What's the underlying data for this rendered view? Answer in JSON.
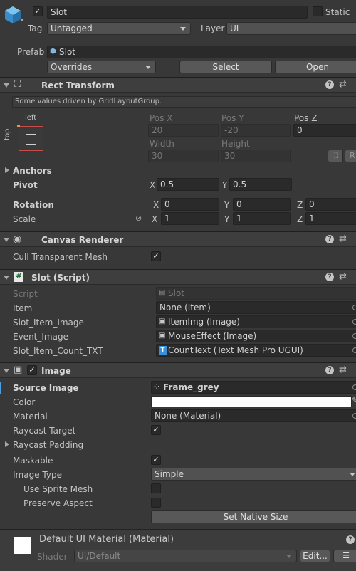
{
  "object": {
    "name": "Slot",
    "static_label": "Static",
    "tag_label": "Tag",
    "tag_value": "Untagged",
    "layer_label": "Layer",
    "layer_value": "UI"
  },
  "prefab": {
    "label": "Prefab",
    "value": "Slot",
    "overrides": "Overrides",
    "select": "Select",
    "open": "Open"
  },
  "rect_transform": {
    "title": "Rect Transform",
    "driven_note": "Some values driven by GridLayoutGroup.",
    "anchor_h": "left",
    "anchor_v": "top",
    "pos_x_label": "Pos X",
    "pos_y_label": "Pos Y",
    "pos_z_label": "Pos Z",
    "pos_x": "20",
    "pos_y": "-20",
    "pos_z": "0",
    "width_label": "Width",
    "height_label": "Height",
    "width": "30",
    "height": "30",
    "r_label": "R",
    "anchors_label": "Anchors",
    "pivot_label": "Pivot",
    "pivot_x": "0.5",
    "pivot_y": "0.5",
    "rotation_label": "Rotation",
    "rot_x": "0",
    "rot_y": "0",
    "rot_z": "0",
    "scale_label": "Scale",
    "scale_x": "1",
    "scale_y": "1",
    "scale_z": "1",
    "x": "X",
    "y": "Y",
    "z": "Z"
  },
  "canvas_renderer": {
    "title": "Canvas Renderer",
    "cull_label": "Cull Transparent Mesh",
    "cull_checked": true
  },
  "slot_script": {
    "title": "Slot (Script)",
    "script_label": "Script",
    "script_value": "Slot",
    "item_label": "Item",
    "item_value": "None (Item)",
    "slot_item_image_label": "Slot_Item_Image",
    "slot_item_image_value": "ItemImg (Image)",
    "event_image_label": "Event_Image",
    "event_image_value": "MouseEffect (Image)",
    "count_txt_label": "Slot_Item_Count_TXT",
    "count_txt_value": "CountText (Text Mesh Pro UGUI)"
  },
  "image": {
    "title": "Image",
    "source_label": "Source Image",
    "source_value": "Frame_grey",
    "color_label": "Color",
    "color_value": "#ffffff",
    "material_label": "Material",
    "material_value": "None (Material)",
    "raycast_target_label": "Raycast Target",
    "raycast_padding_label": "Raycast Padding",
    "maskable_label": "Maskable",
    "image_type_label": "Image Type",
    "image_type_value": "Simple",
    "use_sprite_mesh_label": "Use Sprite Mesh",
    "preserve_aspect_label": "Preserve Aspect",
    "set_native_size": "Set Native Size"
  },
  "material": {
    "title": "Default UI Material (Material)",
    "shader_label": "Shader",
    "shader_value": "UI/Default",
    "edit": "Edit...",
    "list_icon": "list-icon"
  },
  "colors": {
    "panel": "#383838",
    "header": "#3e3e3e",
    "field": "#2a2a2a",
    "accent": "#7fb8e6",
    "anchor_red": "#c84b4b"
  }
}
